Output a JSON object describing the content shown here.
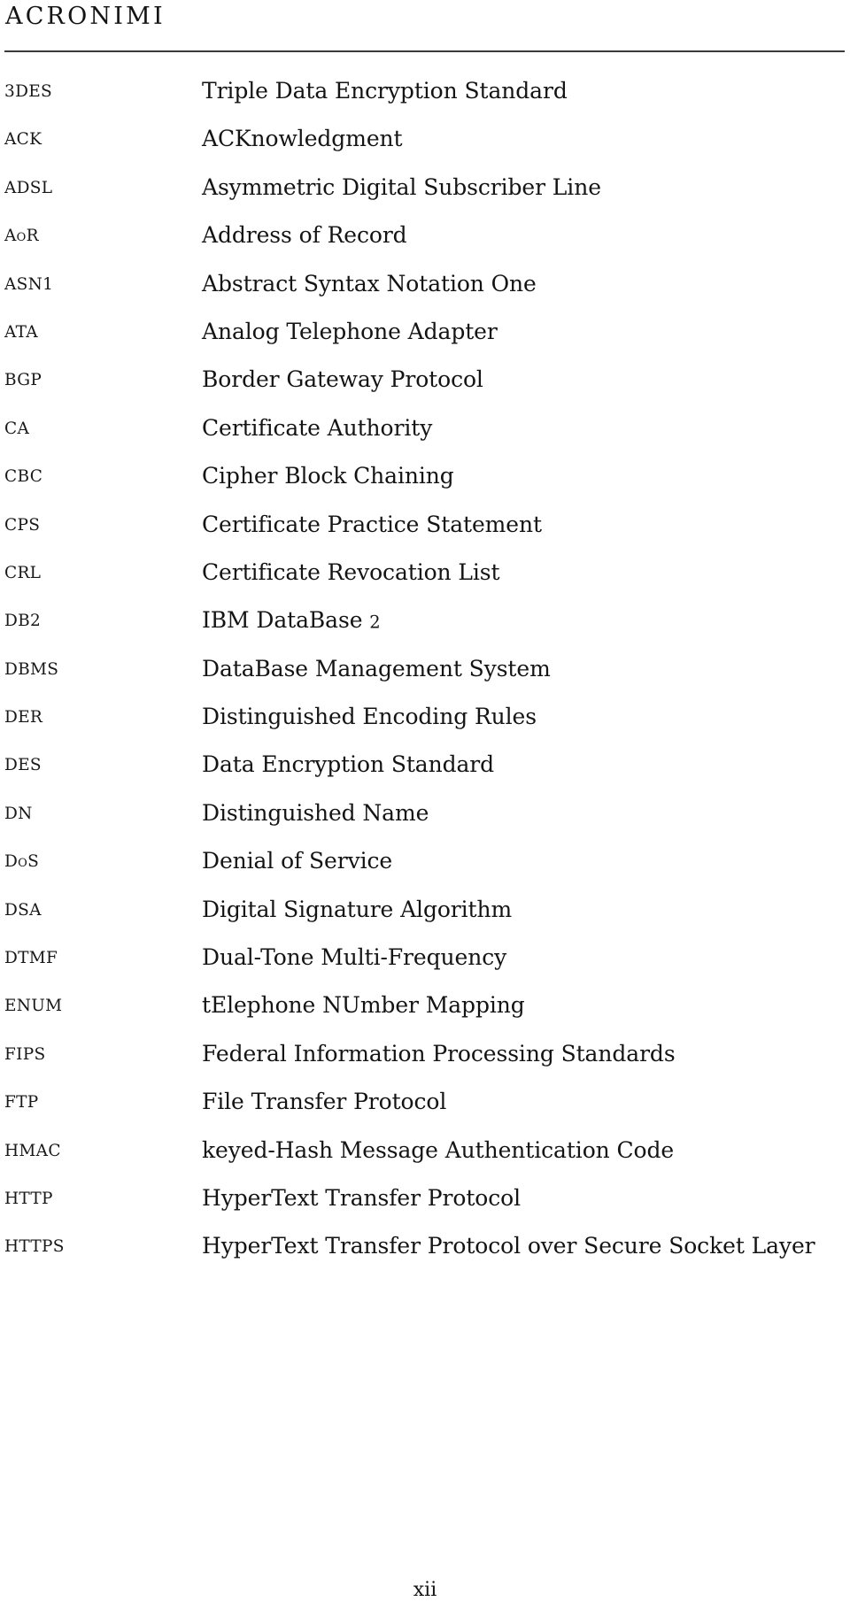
{
  "page": {
    "title": "ACRONIMI",
    "page_number": "xii",
    "background_color": "#ffffff",
    "text_color": "#141414",
    "rule_color": "#3a3a3a"
  },
  "acronyms": [
    {
      "term": "3DES",
      "definition": "Triple Data Encryption Standard"
    },
    {
      "term": "ACK",
      "definition": "ACKnowledgment"
    },
    {
      "term": "ADSL",
      "definition": "Asymmetric Digital Subscriber Line"
    },
    {
      "term": "AoR",
      "definition": "Address of Record"
    },
    {
      "term": "ASN1",
      "definition": "Abstract Syntax Notation One"
    },
    {
      "term": "ATA",
      "definition": "Analog Telephone Adapter"
    },
    {
      "term": "BGP",
      "definition": "Border Gateway Protocol"
    },
    {
      "term": "CA",
      "definition": "Certificate Authority"
    },
    {
      "term": "CBC",
      "definition": "Cipher Block Chaining"
    },
    {
      "term": "CPS",
      "definition": "Certificate Practice Statement"
    },
    {
      "term": "CRL",
      "definition": "Certificate Revocation List"
    },
    {
      "term": "DB2",
      "definition": "IBM DataBase 2"
    },
    {
      "term": "DBMS",
      "definition": "DataBase Management System"
    },
    {
      "term": "DER",
      "definition": "Distinguished Encoding Rules"
    },
    {
      "term": "DES",
      "definition": "Data Encryption Standard"
    },
    {
      "term": "DN",
      "definition": "Distinguished Name"
    },
    {
      "term": "DoS",
      "definition": "Denial of Service"
    },
    {
      "term": "DSA",
      "definition": "Digital Signature Algorithm"
    },
    {
      "term": "DTMF",
      "definition": "Dual-Tone Multi-Frequency"
    },
    {
      "term": "ENUM",
      "definition": "tElephone NUmber Mapping"
    },
    {
      "term": "FIPS",
      "definition": "Federal Information Processing Standards"
    },
    {
      "term": "FTP",
      "definition": "File Transfer Protocol"
    },
    {
      "term": "HMAC",
      "definition": "keyed-Hash Message Authentication Code"
    },
    {
      "term": "HTTP",
      "definition": "HyperText Transfer Protocol"
    },
    {
      "term": "HTTPS",
      "definition": "HyperText Transfer Protocol over Secure Socket Layer"
    }
  ]
}
